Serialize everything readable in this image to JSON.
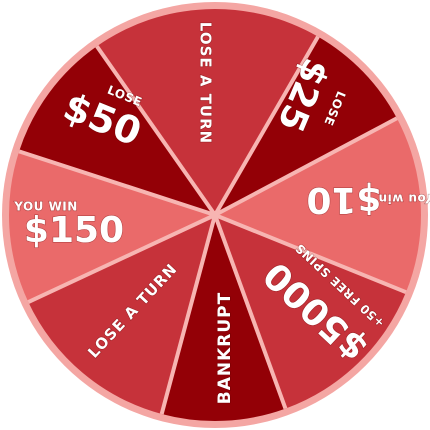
{
  "wheel": {
    "colors": {
      "rim": "#f4a6a3",
      "divider": "#f7b5b2",
      "dark": "#930006",
      "mid": "#c6323a",
      "light": "#ea6a6a",
      "text": "#ffffff"
    },
    "segments": [
      {
        "id": "lose-a-turn-top",
        "color": "mid",
        "lines": [
          "LOSE A TURN"
        ]
      },
      {
        "id": "lose-25",
        "color": "dark",
        "lines": [
          "LOSE",
          "$25"
        ]
      },
      {
        "id": "you-win-10",
        "color": "light",
        "lines": [
          "You win",
          "$10"
        ]
      },
      {
        "id": "5000-free-spins",
        "color": "mid",
        "lines": [
          "+50 FREE SPINS",
          "$5000"
        ]
      },
      {
        "id": "bankrupt",
        "color": "dark",
        "lines": [
          "BANKRUPT"
        ]
      },
      {
        "id": "lose-a-turn-bottom",
        "color": "mid",
        "lines": [
          "LOSE A TURN"
        ]
      },
      {
        "id": "you-win-150",
        "color": "light",
        "lines": [
          "YOU WIN",
          "$150"
        ]
      },
      {
        "id": "lose-50",
        "color": "dark",
        "lines": [
          "LOSE",
          "$50"
        ]
      }
    ]
  }
}
